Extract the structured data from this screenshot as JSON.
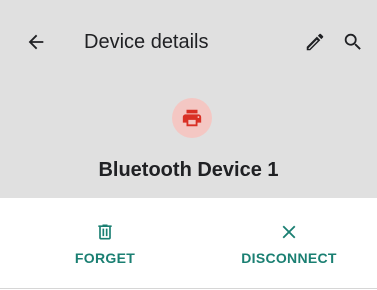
{
  "app_bar": {
    "title": "Device details",
    "back_icon": "arrow-back-icon",
    "edit_icon": "pencil-icon",
    "search_icon": "search-icon"
  },
  "device": {
    "name": "Bluetooth Device 1",
    "icon": "printer-icon"
  },
  "actions": [
    {
      "label": "FORGET",
      "icon": "trash-icon"
    },
    {
      "label": "DISCONNECT",
      "icon": "close-icon"
    }
  ],
  "colors": {
    "header_bg": "#e0e0e0",
    "accent": "#1a7f72",
    "device_icon": "#d93025",
    "device_avatar_bg": "#f4c7c3"
  }
}
